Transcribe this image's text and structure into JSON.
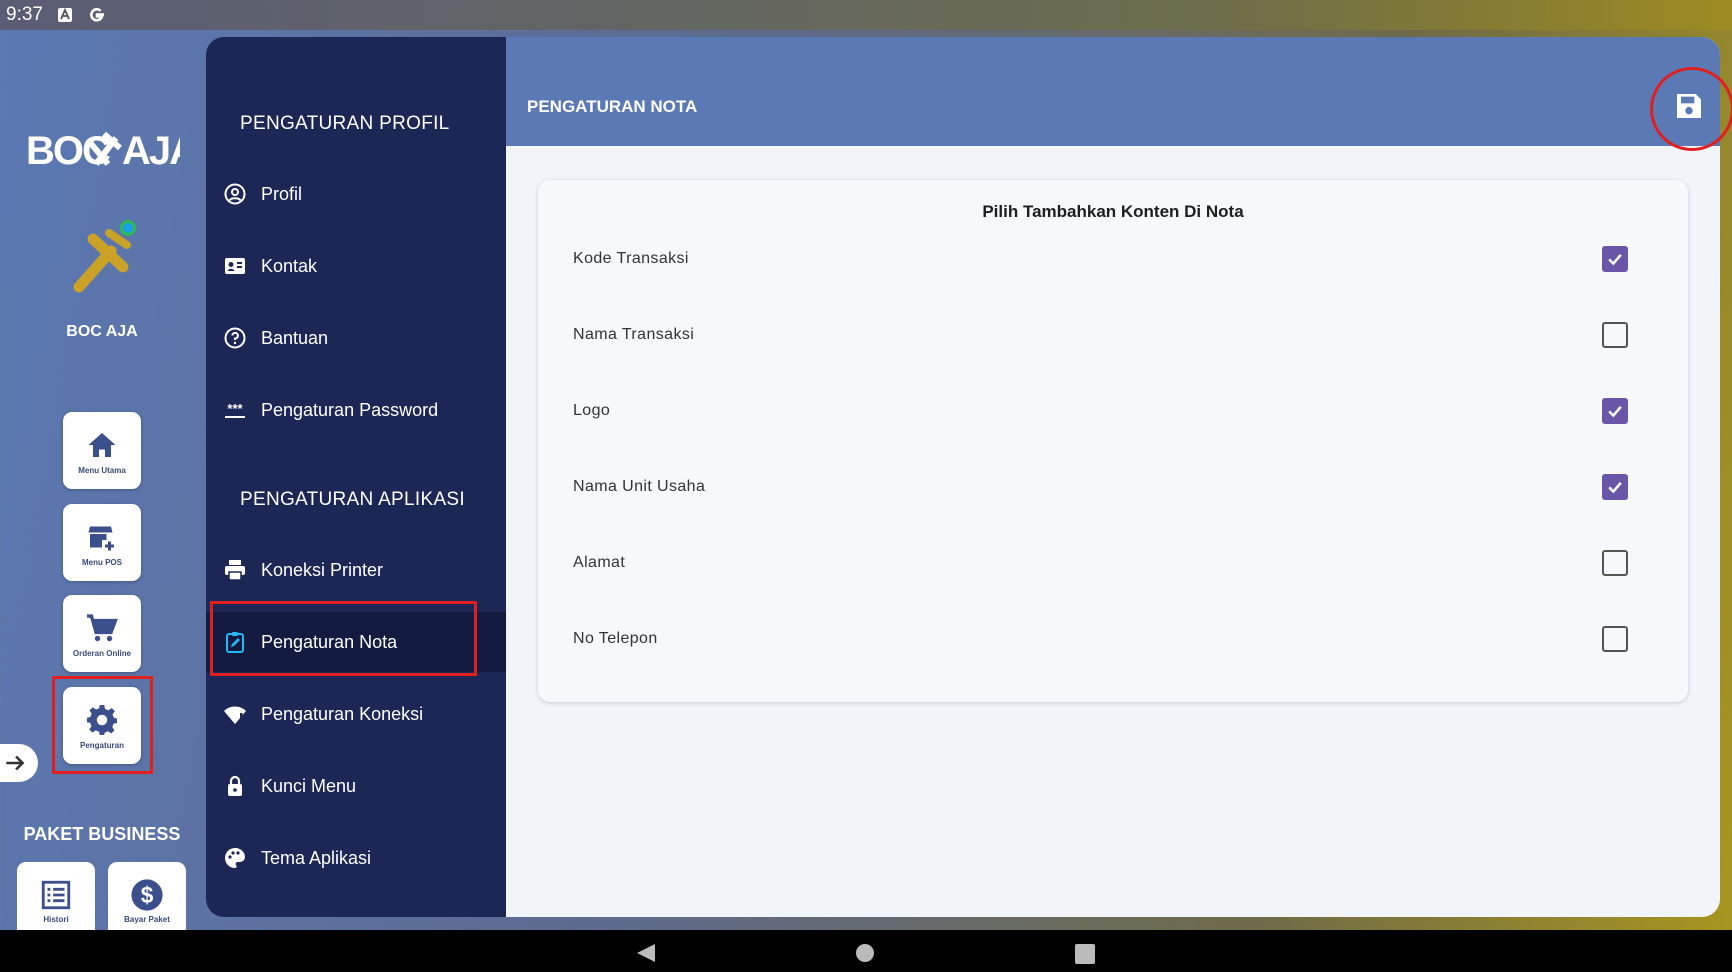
{
  "status_bar": {
    "time": "9:37",
    "icons": [
      "notification-a-icon",
      "google-icon"
    ]
  },
  "rail": {
    "brand": "BOC AJA",
    "store_name": "BOC AJA",
    "buttons": [
      {
        "label": "Menu Utama",
        "icon": "home-icon"
      },
      {
        "label": "Menu POS",
        "icon": "store-add-icon"
      },
      {
        "label": "Orderan Online",
        "icon": "cart-icon"
      },
      {
        "label": "Pengaturan",
        "icon": "gear-icon"
      }
    ],
    "paket_label": "PAKET BUSINESS",
    "paket_buttons": [
      {
        "label": "Histori",
        "icon": "list-icon"
      },
      {
        "label": "Bayar Paket",
        "icon": "dollar-icon"
      }
    ]
  },
  "menu": {
    "section_profile": "PENGATURAN PROFIL",
    "profile_items": [
      {
        "label": "Profil",
        "icon": "account-circle-icon"
      },
      {
        "label": "Kontak",
        "icon": "contact-card-icon"
      },
      {
        "label": "Bantuan",
        "icon": "help-circle-icon"
      },
      {
        "label": "Pengaturan Password",
        "icon": "password-icon"
      }
    ],
    "section_app": "PENGATURAN APLIKASI",
    "app_items": [
      {
        "label": "Koneksi Printer",
        "icon": "printer-icon"
      },
      {
        "label": "Pengaturan Nota",
        "icon": "receipt-edit-icon",
        "active": true
      },
      {
        "label": "Pengaturan Koneksi",
        "icon": "wifi-alert-icon"
      },
      {
        "label": "Kunci Menu",
        "icon": "lock-icon"
      },
      {
        "label": "Tema Aplikasi",
        "icon": "palette-icon"
      }
    ]
  },
  "main": {
    "title": "PENGATURAN NOTA",
    "save_icon": "save-icon",
    "card_title": "Pilih Tambahkan Konten Di Nota",
    "options": [
      {
        "label": "Kode Transaksi",
        "checked": true
      },
      {
        "label": "Nama Transaksi",
        "checked": false
      },
      {
        "label": "Logo",
        "checked": true
      },
      {
        "label": "Nama Unit Usaha",
        "checked": true
      },
      {
        "label": "Alamat",
        "checked": false
      },
      {
        "label": "No Telepon",
        "checked": false
      }
    ]
  },
  "colors": {
    "panel_dark": "#1c2756",
    "header_blue": "#5b79b4",
    "checkbox_purple": "#6a56a8",
    "highlight_red": "#e02020",
    "brand_gold": "#c9a227"
  }
}
